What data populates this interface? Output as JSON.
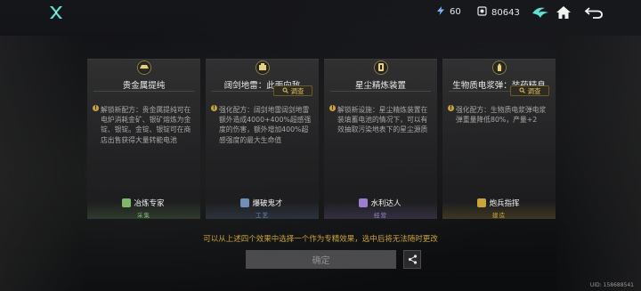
{
  "topbar": {
    "logo_icon": "game-logo-x-icon",
    "resource1_value": "60",
    "resource1_icon": "energy-icon",
    "resource2_value": "80643",
    "resource2_icon": "currency-icon",
    "buttons": [
      "faction-emblem-icon",
      "home-icon",
      "back-arrow-icon"
    ]
  },
  "cards": [
    {
      "icon": "ingot-icon",
      "title": "贵金属提纯",
      "has_investigate": false,
      "desc": "解锁新配方：贵金属提纯可在电炉消耗金矿、银矿熔炼为金锭、银锭。金锭、银锭可在商店出售获得大量转能电池",
      "badge": "冶炼专家",
      "badge_sub": "采集",
      "accent": "#7fb86a"
    },
    {
      "icon": "mine-icon",
      "title": "阔剑地雷：此面向敌",
      "has_investigate": true,
      "investigate": "调查",
      "desc": "强化配方：阔剑地雷阔剑地雷额外造成4000+400%超感强度的伤害，额外增加400%超感强度的最大生命值",
      "badge": "爆破鬼才",
      "badge_sub": "工艺",
      "accent": "#6f8fb8"
    },
    {
      "icon": "purifier-icon",
      "title": "星尘精炼装置",
      "has_investigate": false,
      "desc": "解锁新设施：星尘精炼装置在装填蓄电池的情况下，可以有效抽取污染地表下的星尘源质",
      "badge": "水利达人",
      "badge_sub": "经营",
      "accent": "#9a7fd0"
    },
    {
      "icon": "shell-icon",
      "title": "生物质电浆弹：装药精良",
      "has_investigate": true,
      "investigate": "调查",
      "desc": "强化配方：生物质电浆弹电浆弹重量降低80%，产量+2",
      "badge": "炮兵指挥",
      "badge_sub": "建造",
      "accent": "#c9a43b"
    }
  ],
  "hint": "可以从上述四个效果中选择一个作为专精效果，选中后将无法随时更改",
  "confirm_label": "确定",
  "share_icon": "share-icon",
  "uid": "UID: 158688541"
}
